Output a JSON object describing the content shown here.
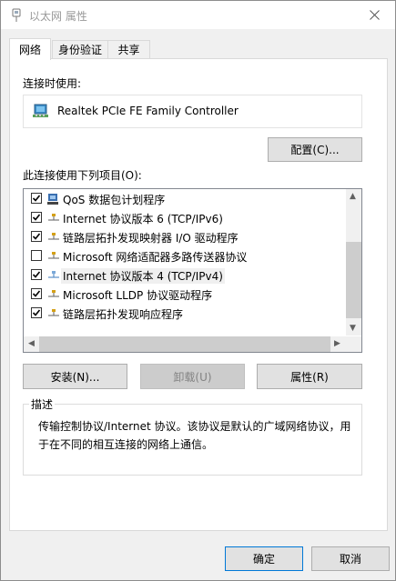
{
  "window": {
    "title": "以太网 属性"
  },
  "tabs": [
    {
      "label": "网络",
      "active": true
    },
    {
      "label": "身份验证",
      "active": false
    },
    {
      "label": "共享",
      "active": false
    }
  ],
  "connect_using_label": "连接时使用:",
  "adapter": {
    "name": "Realtek PCIe FE Family Controller",
    "icon": "network-adapter-icon"
  },
  "configure_button": "配置(C)...",
  "items_label": "此连接使用下列项目(O):",
  "items": [
    {
      "label": "QoS 数据包计划程序",
      "checked": true,
      "icon": "qos-icon"
    },
    {
      "label": "Internet 协议版本 6 (TCP/IPv6)",
      "checked": true,
      "icon": "protocol-icon"
    },
    {
      "label": "链路层拓扑发现映射器 I/O 驱动程序",
      "checked": true,
      "icon": "protocol-icon"
    },
    {
      "label": "Microsoft 网络适配器多路传送器协议",
      "checked": false,
      "icon": "protocol-icon"
    },
    {
      "label": "Internet 协议版本 4 (TCP/IPv4)",
      "checked": true,
      "icon": "protocol-icon",
      "selected": true
    },
    {
      "label": "Microsoft LLDP 协议驱动程序",
      "checked": true,
      "icon": "protocol-icon"
    },
    {
      "label": "链路层拓扑发现响应程序",
      "checked": true,
      "icon": "protocol-icon"
    }
  ],
  "buttons": {
    "install": "安装(N)...",
    "uninstall": "卸载(U)",
    "properties": "属性(R)"
  },
  "description": {
    "title": "描述",
    "text": "传输控制协议/Internet 协议。该协议是默认的广域网络协议，用于在不同的相互连接的网络上通信。"
  },
  "footer": {
    "ok": "确定",
    "cancel": "取消"
  },
  "colors": {
    "accent": "#0078d7",
    "title_inactive": "#999999",
    "selection": "#f0f0f0"
  }
}
